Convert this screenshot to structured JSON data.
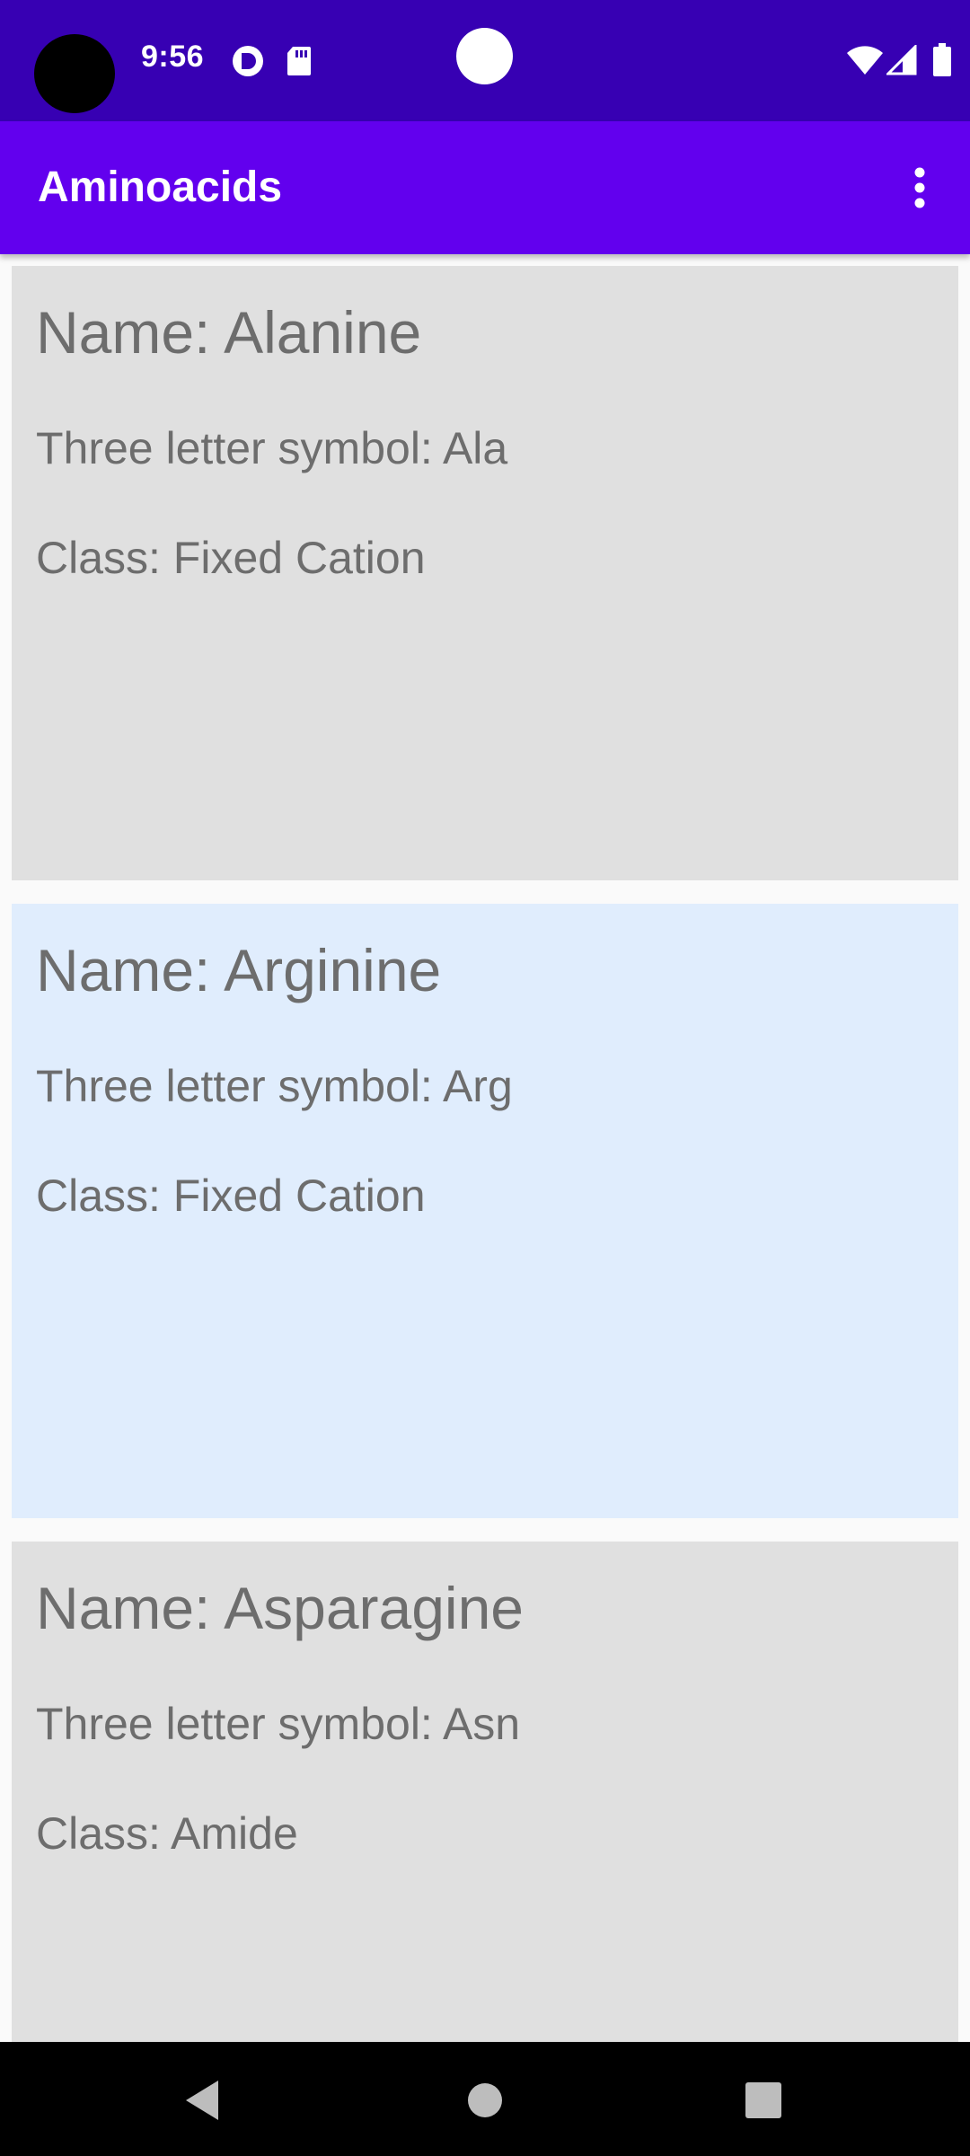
{
  "status_bar": {
    "time": "9:56",
    "icons": [
      "notification-icon",
      "sd-card-icon",
      "wifi-icon",
      "signal-icon",
      "battery-icon"
    ]
  },
  "app_bar": {
    "title": "Aminoacids",
    "menu_icon": "more-vert-icon"
  },
  "aminoacids": [
    {
      "name": "Name: Alanine",
      "symbol": "Three letter symbol: Ala",
      "class": "Class: Fixed Cation",
      "background": "#e0e0e0"
    },
    {
      "name": "Name: Arginine",
      "symbol": "Three letter symbol: Arg",
      "class": "Class: Fixed Cation",
      "background": "#e0edfd"
    },
    {
      "name": "Name: Asparagine",
      "symbol": "Three letter symbol: Asn",
      "class": "Class: Amide",
      "background": "#e0e0e0"
    }
  ],
  "nav_bar": {
    "icons": [
      "back-icon",
      "home-icon",
      "recents-icon"
    ]
  },
  "colors": {
    "status_bar": "#3700b3",
    "app_bar": "#6200ee",
    "card_default": "#e0e0e0",
    "card_highlight": "#e0edfd",
    "card_text": "#6d6d6d"
  }
}
